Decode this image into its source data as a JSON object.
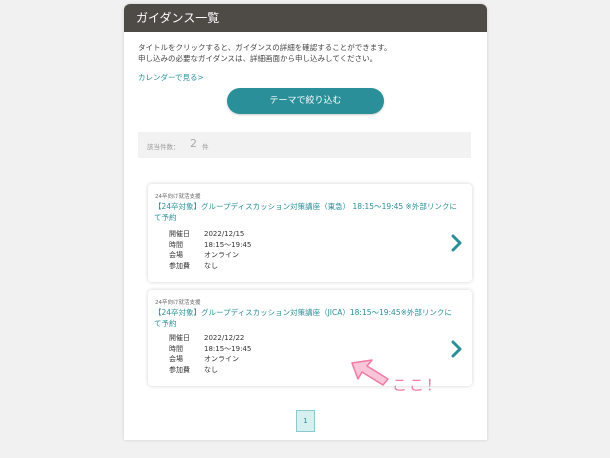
{
  "header": {
    "title": "ガイダンス一覧"
  },
  "intro": {
    "line1": "タイトルをクリックすると、ガイダンスの詳細を確認することができます。",
    "line2": "申し込みの必要なガイダンスは、詳細画面から申し込みしてください。"
  },
  "calendar_link": "カレンダーで見る>",
  "filter_button": "テーマで絞り込む",
  "count": {
    "label": "該当件数：",
    "value": "2",
    "unit": "件"
  },
  "cards": [
    {
      "tag": "24卒向け就活支援",
      "title": "【24卒対象】グループディスカッション対策講座（東急） 18:15～19:45 ※外部リンクにて予約",
      "rows": [
        {
          "k": "開催日",
          "v": "2022/12/15"
        },
        {
          "k": "時間",
          "v": "18:15～19:45"
        },
        {
          "k": "会場",
          "v": "オンライン"
        },
        {
          "k": "参加費",
          "v": "なし"
        }
      ]
    },
    {
      "tag": "24卒向け就活支援",
      "title": "【24卒対象】グループディスカッション対策講座（JICA）18:15～19:45※外部リンクにて予約",
      "rows": [
        {
          "k": "開催日",
          "v": "2022/12/22"
        },
        {
          "k": "時間",
          "v": "18:15～19:45"
        },
        {
          "k": "会場",
          "v": "オンライン"
        },
        {
          "k": "参加費",
          "v": "なし"
        }
      ]
    }
  ],
  "pagination": {
    "current": "1"
  },
  "annotation": {
    "text": "ここ！",
    "color": "#f07aa5"
  },
  "colors": {
    "accent": "#2a8f98",
    "header_bg": "#4e4a46"
  }
}
